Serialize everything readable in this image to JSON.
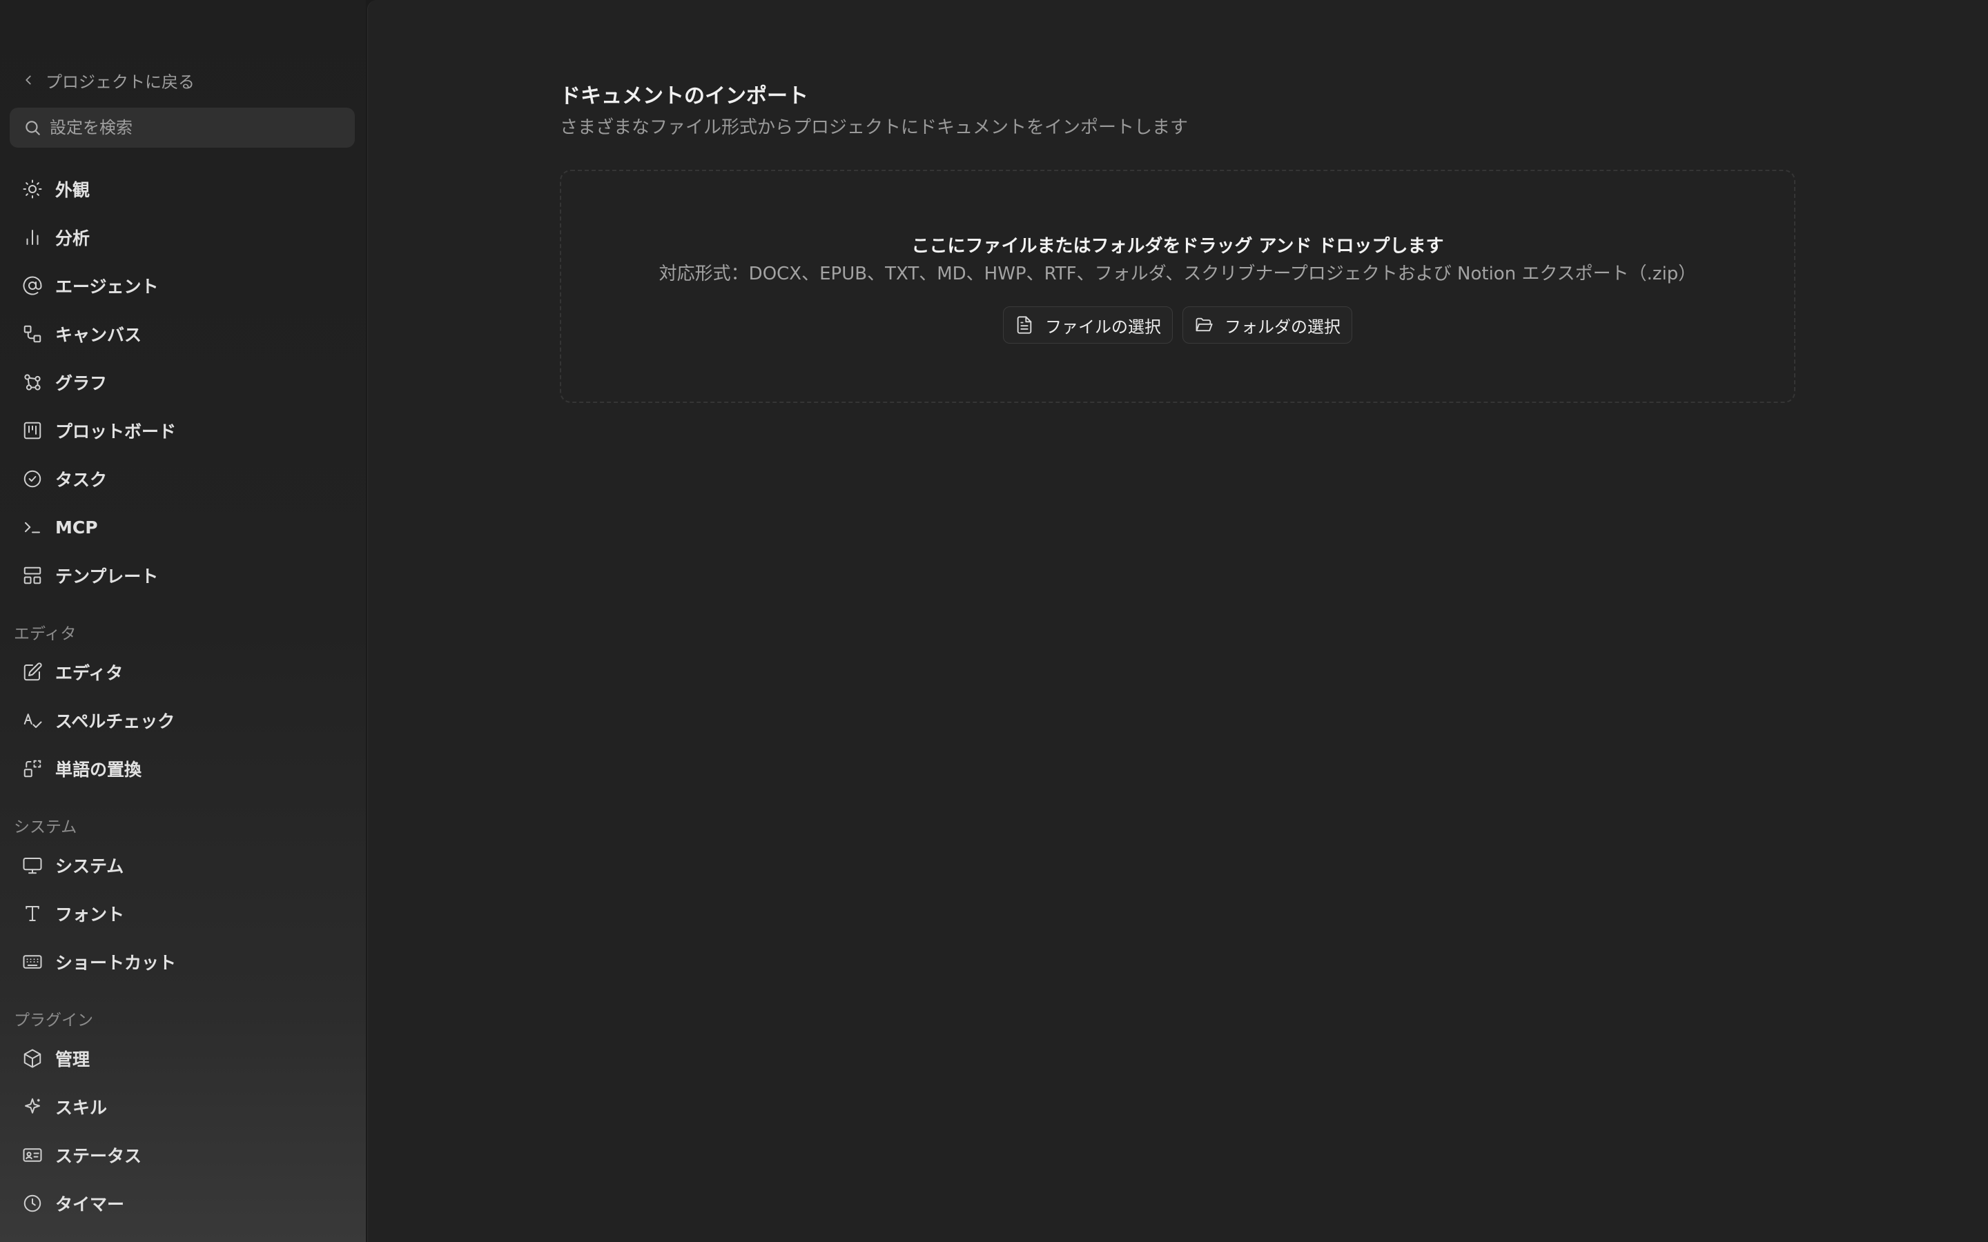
{
  "sidebar": {
    "back_label": "プロジェクトに戻る",
    "search_placeholder": "設定を検索",
    "items_general": [
      {
        "label": "外観",
        "icon": "sun-icon"
      },
      {
        "label": "分析",
        "icon": "bar-chart-icon"
      },
      {
        "label": "エージェント",
        "icon": "at-sign-icon"
      },
      {
        "label": "キャンバス",
        "icon": "canvas-icon"
      },
      {
        "label": "グラフ",
        "icon": "graph-icon"
      },
      {
        "label": "プロットボード",
        "icon": "kanban-icon"
      },
      {
        "label": "タスク",
        "icon": "check-circle-icon"
      },
      {
        "label": "MCP",
        "icon": "terminal-icon"
      },
      {
        "label": "テンプレート",
        "icon": "layout-icon"
      }
    ],
    "section_editor": "エディタ",
    "items_editor": [
      {
        "label": "エディタ",
        "icon": "edit-icon"
      },
      {
        "label": "スペルチェック",
        "icon": "spell-check-icon"
      },
      {
        "label": "単語の置換",
        "icon": "replace-icon"
      }
    ],
    "section_system": "システム",
    "items_system": [
      {
        "label": "システム",
        "icon": "monitor-icon"
      },
      {
        "label": "フォント",
        "icon": "type-icon"
      },
      {
        "label": "ショートカット",
        "icon": "keyboard-icon"
      }
    ],
    "section_plugins": "プラグイン",
    "items_plugins": [
      {
        "label": "管理",
        "icon": "package-icon"
      },
      {
        "label": "スキル",
        "icon": "sparkle-icon"
      },
      {
        "label": "ステータス",
        "icon": "id-card-icon"
      },
      {
        "label": "タイマー",
        "icon": "clock-icon"
      }
    ]
  },
  "main": {
    "title": "ドキュメントのインポート",
    "subtitle": "さまざまなファイル形式からプロジェクトにドキュメントをインポートします",
    "dropzone": {
      "title": "ここにファイルまたはフォルダをドラッグ アンド ドロップします",
      "formats": "対応形式：DOCX、EPUB、TXT、MD、HWP、RTF、フォルダ、スクリブナープロジェクトおよび Notion エクスポート（.zip）",
      "select_file_label": "ファイルの選択",
      "select_folder_label": "フォルダの選択"
    }
  }
}
